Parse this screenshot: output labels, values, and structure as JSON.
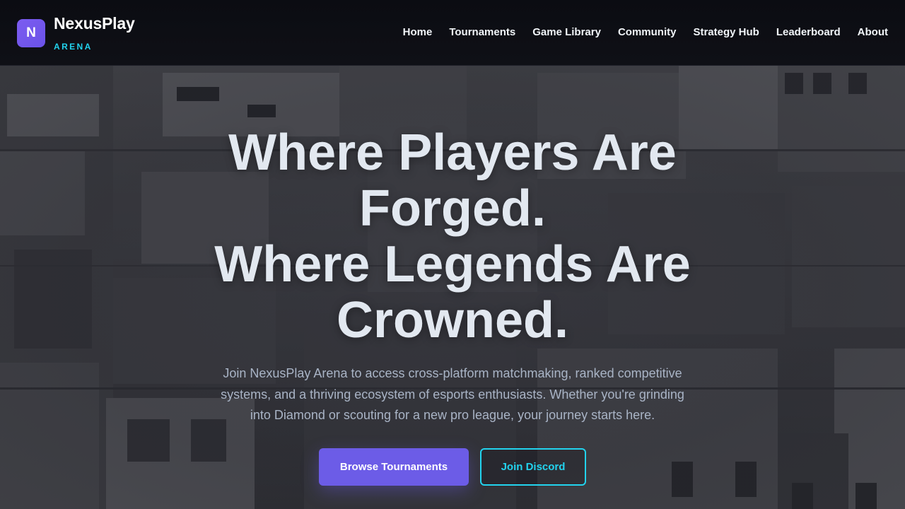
{
  "brand": {
    "logo_letter": "N",
    "name": "NexusPlay",
    "subtitle": "ARENA",
    "accent_color": "#6c5ce7",
    "secondary_color": "#22d3ee"
  },
  "nav": {
    "items": [
      {
        "label": "Home"
      },
      {
        "label": "Tournaments"
      },
      {
        "label": "Game Library"
      },
      {
        "label": "Community"
      },
      {
        "label": "Strategy Hub"
      },
      {
        "label": "Leaderboard"
      },
      {
        "label": "About"
      }
    ]
  },
  "hero": {
    "background": "grayscale aerial photo of city rooftops",
    "title_lines": [
      "Where Players Are",
      "Forged.",
      "Where Legends Are",
      "Crowned."
    ],
    "description": "Join NexusPlay Arena to access cross-platform matchmaking, ranked competitive systems, and a thriving ecosystem of esports enthusiasts. Whether you're grinding into Diamond or scouting for a new pro league, your journey starts here.",
    "primary_button": "Browse Tournaments",
    "secondary_button": "Join Discord"
  }
}
